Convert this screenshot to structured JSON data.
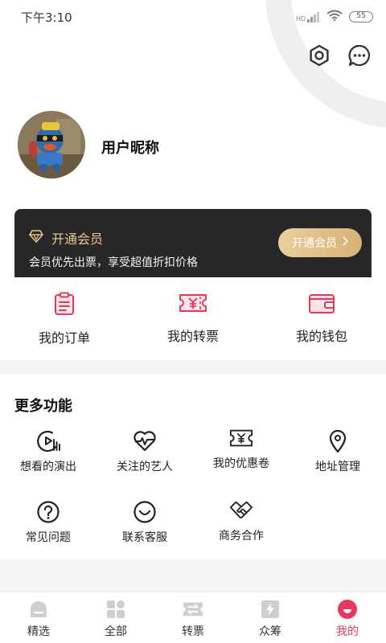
{
  "status_bar": {
    "time": "下午3:10",
    "network": "HD",
    "battery": "55"
  },
  "profile": {
    "nickname": "用户昵称"
  },
  "vip": {
    "title": "开通会员",
    "description": "会员优先出票，享受超值折扣价格",
    "button_label": "开通会员"
  },
  "quick_actions": [
    {
      "label": "我的订单",
      "icon": "order-icon"
    },
    {
      "label": "我的转票",
      "icon": "ticket-transfer-icon"
    },
    {
      "label": "我的钱包",
      "icon": "wallet-icon"
    }
  ],
  "more_functions": {
    "title": "更多功能",
    "items": [
      {
        "label": "想看的演出",
        "icon": "watch-show-icon"
      },
      {
        "label": "关注的艺人",
        "icon": "heart-pulse-icon"
      },
      {
        "label": "我的优惠卷",
        "icon": "coupon-icon"
      },
      {
        "label": "地址管理",
        "icon": "location-icon"
      },
      {
        "label": "常见问题",
        "icon": "question-icon"
      },
      {
        "label": "联系客服",
        "icon": "smile-icon"
      },
      {
        "label": "商务合作",
        "icon": "handshake-icon"
      }
    ]
  },
  "tab_bar": [
    {
      "label": "精选",
      "icon": "home-icon",
      "active": false
    },
    {
      "label": "全部",
      "icon": "grid-icon",
      "active": false
    },
    {
      "label": "转票",
      "icon": "transfer-icon",
      "active": false
    },
    {
      "label": "众筹",
      "icon": "lightning-icon",
      "active": false
    },
    {
      "label": "我的",
      "icon": "profile-icon",
      "active": true
    }
  ],
  "colors": {
    "accent": "#e8375b",
    "gold": "#e9c98f",
    "card_dark": "#272727"
  }
}
